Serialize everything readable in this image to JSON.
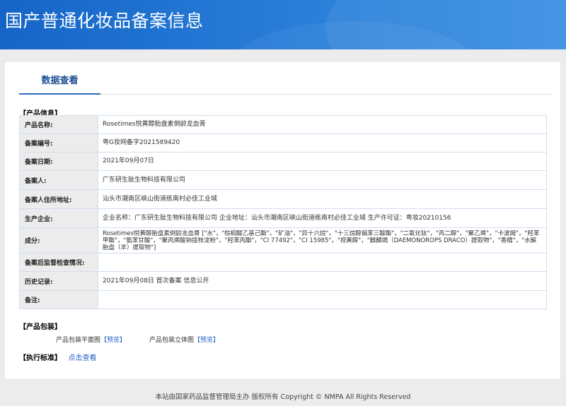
{
  "site": {
    "title": "国产普通化妆品备案信息"
  },
  "tabs": [
    {
      "label": "数据查看"
    }
  ],
  "product_info": {
    "section_title": "【产品信息】",
    "rows": [
      {
        "label": "产品名称:",
        "value": "Rosetimes悦黄醇胎盘素倒龄龙血膏"
      },
      {
        "label": "备案编号:",
        "value": "粤G妆网备字2021589420"
      },
      {
        "label": "备案日期:",
        "value": "2021年09月07日"
      },
      {
        "label": "备案人:",
        "value": "广东研生肽生物科技有限公司"
      },
      {
        "label": "备案人住所地址:",
        "value": "汕头市潮南区峡山街道练南村必佳工业城"
      },
      {
        "label": "生产企业:",
        "value": "企业名称：广东研生肽生物科技有限公司 企业地址：汕头市潮南区峡山街道练南村必佳工业城 生产许可证：粤妆20210156"
      },
      {
        "label": "成分:",
        "value": "Rosetimes悦黄醇胎盘素倒龄龙血膏 [\"水\"，\"棕榈酸乙基己酯\"，\"矿油\"，\"异十六烷\"，\"十三烷醇偏苯三酸酯\"，\"二氧化钛\"，\"丙二醇\"，\"聚乙烯\"，\"卡波姆\"，\"羟苯甲酯\"，\"氨苯甘酸\"，\"聚丙烯酸钠接枝淀粉\"，\"羟苯丙酯\"，\"CI 77492\"，\"CI 15985\"，\"视黄醇\"，\"麒麟竭（DAEMONOROPS DRACO）提取物\"，\"香精\"，\"水解胎盘（羊）提取物\"]"
      },
      {
        "label": "备案后监督检查情况:",
        "value": ""
      },
      {
        "label": "历史记录:",
        "value": "2021年09月08日 首次备案 信息公开"
      },
      {
        "label": "备注:",
        "value": ""
      }
    ]
  },
  "packaging": {
    "section_title": "【产品包装】",
    "flat_label": "产品包装平面图",
    "flat_link": "【预览】",
    "solid_label": "产品包装立体图",
    "solid_link": "【预览】"
  },
  "standard": {
    "section_title": "【执行标准】",
    "link": "点击查看"
  },
  "footer": {
    "text": "本站由国家药品监督管理局主办 版权所有 Copyright © NMPA All Rights Reserved"
  }
}
